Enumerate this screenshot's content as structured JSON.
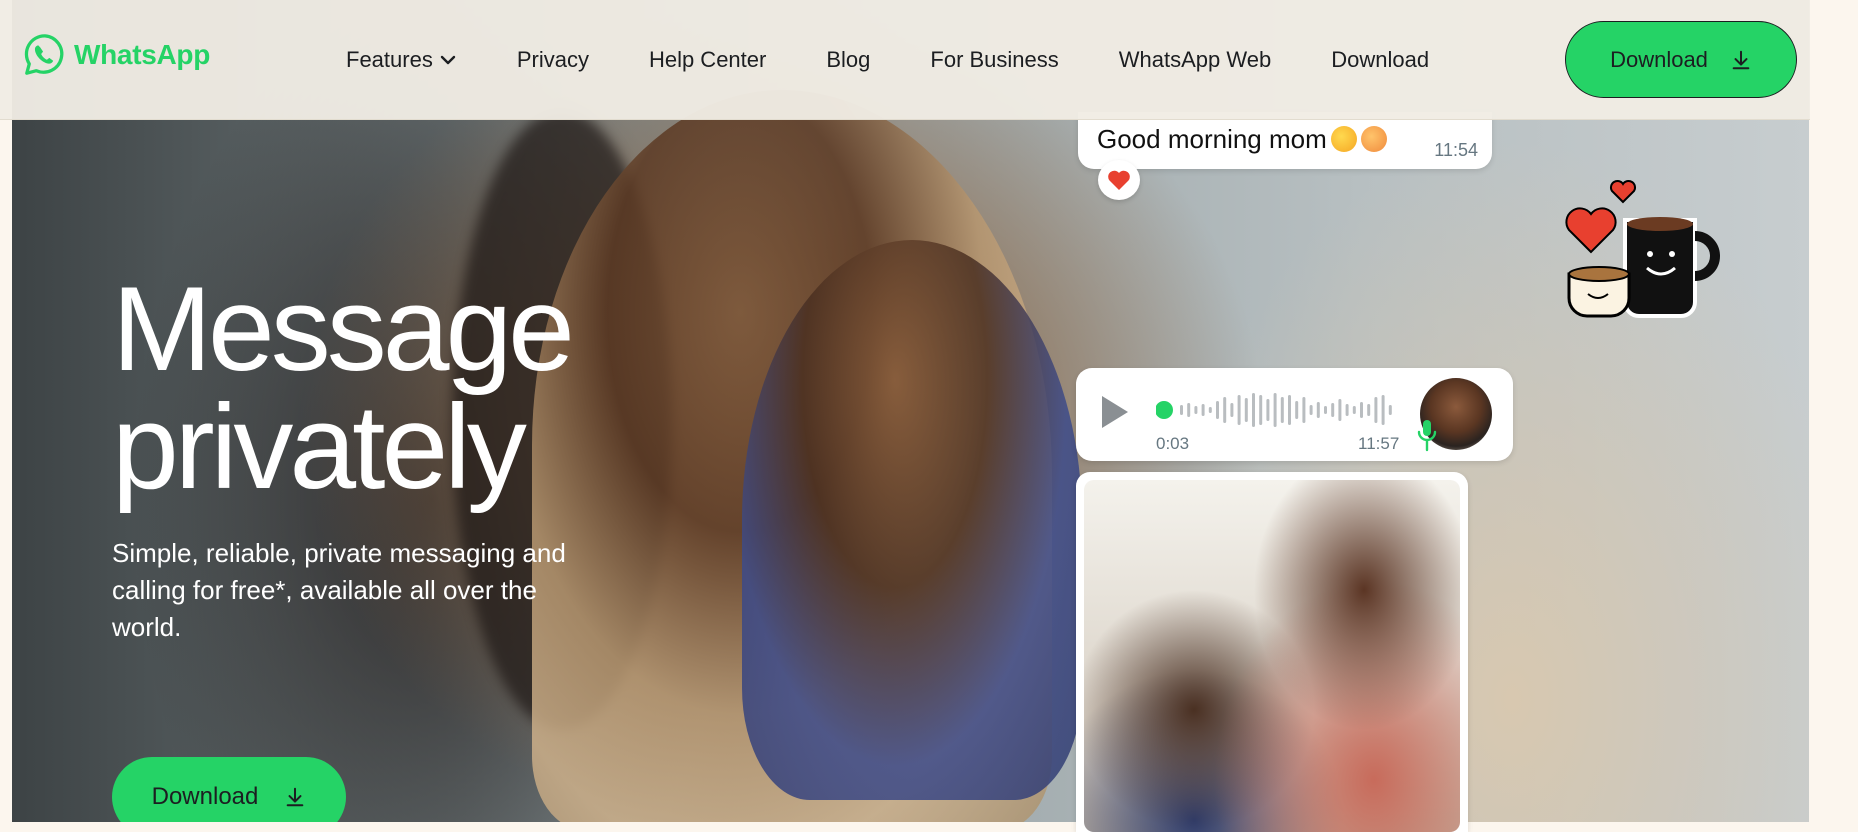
{
  "brand": {
    "name": "WhatsApp",
    "color": "#25d366"
  },
  "nav": {
    "items": [
      {
        "label": "Features",
        "has_dropdown": true
      },
      {
        "label": "Privacy"
      },
      {
        "label": "Help Center"
      },
      {
        "label": "Blog"
      },
      {
        "label": "For Business"
      },
      {
        "label": "WhatsApp Web"
      },
      {
        "label": "Download"
      }
    ],
    "cta_label": "Download"
  },
  "hero": {
    "headline_line1": "Message",
    "headline_line2": "privately",
    "subtitle": "Simple, reliable, private messaging and calling for free*, available all over the world.",
    "cta_label": "Download"
  },
  "chat": {
    "text_message": "Good morning mom",
    "text_time": "11:54",
    "reaction": "heart",
    "voice": {
      "elapsed": "0:03",
      "time": "11:57"
    }
  },
  "icons": [
    "whatsapp-logo-icon",
    "chevron-down-icon",
    "download-icon",
    "play-icon",
    "mic-icon",
    "heart-icon"
  ]
}
